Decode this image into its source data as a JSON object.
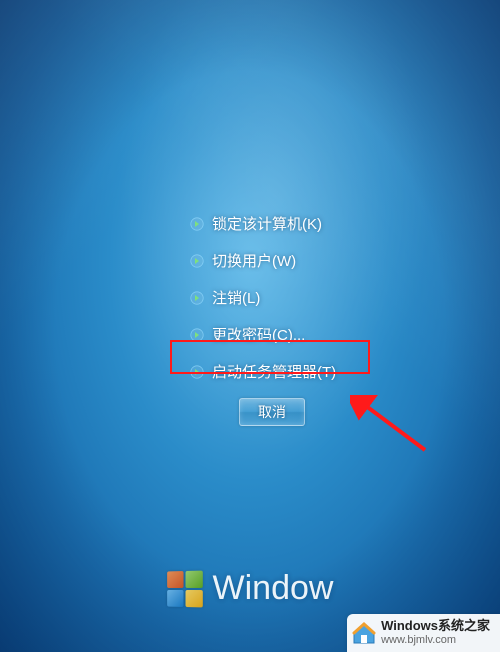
{
  "menu": {
    "items": [
      {
        "label": "锁定该计算机(K)"
      },
      {
        "label": "切换用户(W)"
      },
      {
        "label": "注销(L)"
      },
      {
        "label": "更改密码(C)..."
      },
      {
        "label": "启动任务管理器(T)"
      }
    ]
  },
  "cancel": {
    "label": "取消"
  },
  "brand": {
    "text": "Window"
  },
  "watermark": {
    "title": "Windows系统之家",
    "url": "www.bjmlv.com"
  }
}
